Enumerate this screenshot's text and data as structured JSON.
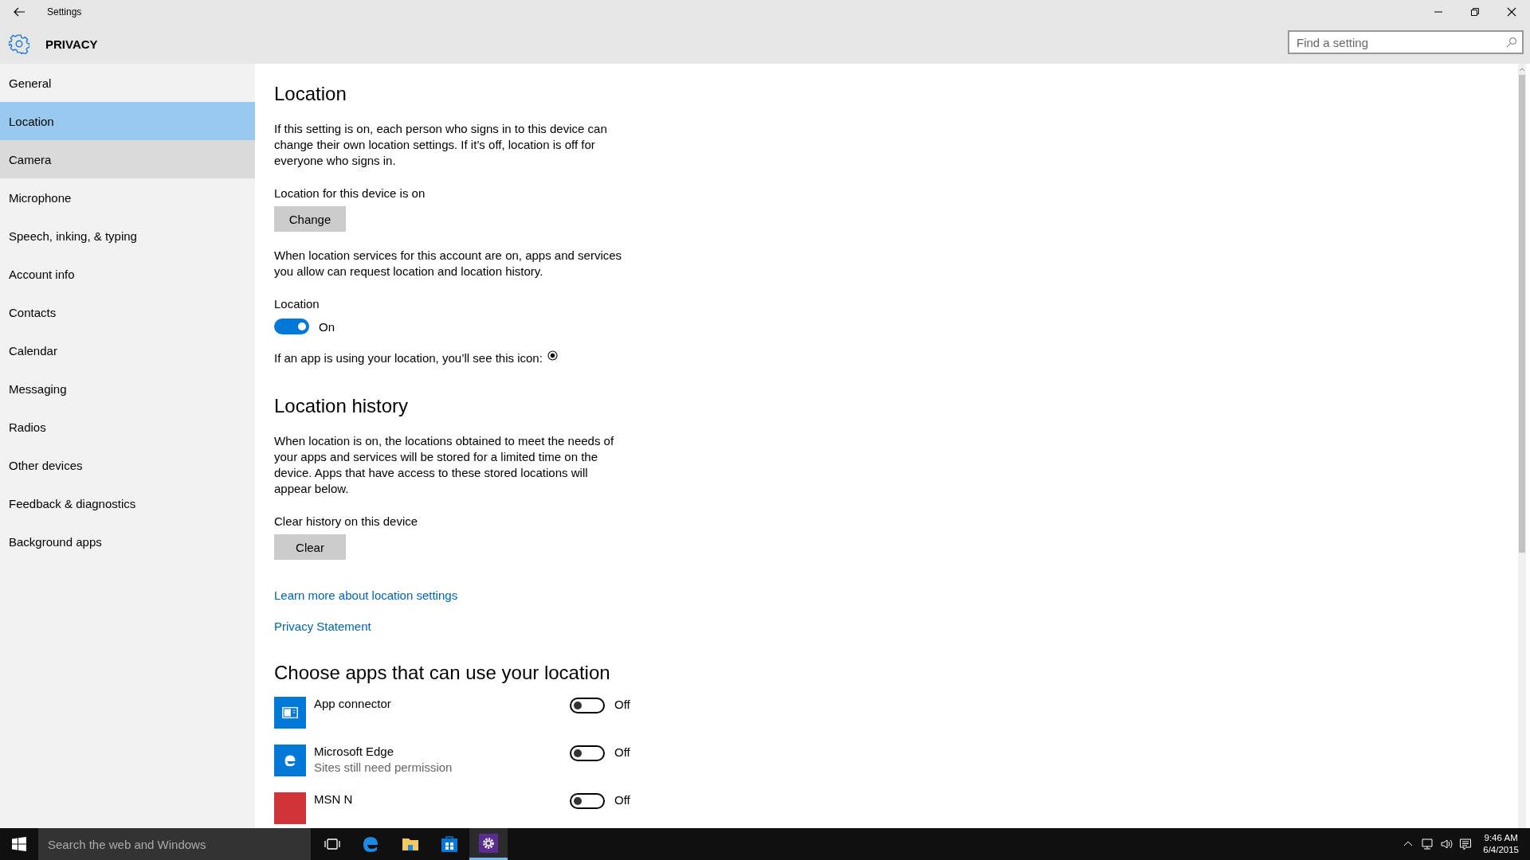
{
  "window": {
    "title": "Settings"
  },
  "header": {
    "title": "PRIVACY"
  },
  "search": {
    "placeholder": "Find a setting"
  },
  "sidebar": {
    "items": [
      {
        "label": "General",
        "selected": false,
        "hovered": false
      },
      {
        "label": "Location",
        "selected": true,
        "hovered": false
      },
      {
        "label": "Camera",
        "selected": false,
        "hovered": true
      },
      {
        "label": "Microphone",
        "selected": false,
        "hovered": false
      },
      {
        "label": "Speech, inking, & typing",
        "selected": false,
        "hovered": false
      },
      {
        "label": "Account info",
        "selected": false,
        "hovered": false
      },
      {
        "label": "Contacts",
        "selected": false,
        "hovered": false
      },
      {
        "label": "Calendar",
        "selected": false,
        "hovered": false
      },
      {
        "label": "Messaging",
        "selected": false,
        "hovered": false
      },
      {
        "label": "Radios",
        "selected": false,
        "hovered": false
      },
      {
        "label": "Other devices",
        "selected": false,
        "hovered": false
      },
      {
        "label": "Feedback & diagnostics",
        "selected": false,
        "hovered": false
      },
      {
        "label": "Background apps",
        "selected": false,
        "hovered": false
      }
    ]
  },
  "content": [
    {
      "kind": "heading",
      "text": "Location"
    },
    {
      "kind": "text",
      "text": "If this setting is on, each person who signs in to this device can change their own location settings. If it’s off, location is off for everyone who signs in."
    },
    {
      "kind": "label",
      "text": "Location for this device is on"
    },
    {
      "kind": "button",
      "text": "Change"
    },
    {
      "kind": "text",
      "text": "When location services for this account are on, apps and services you allow can request location and location history."
    },
    {
      "kind": "toggle",
      "label": "Location",
      "on": true,
      "state_text": "On"
    },
    {
      "kind": "icon_text",
      "text": "If an app is using your location, you’ll see this icon:"
    },
    {
      "kind": "heading",
      "text": "Location history"
    },
    {
      "kind": "text",
      "text": "When location is on, the locations obtained to meet the needs of your apps and services will be stored for a limited time on the device. Apps that have access to these stored locations will appear below."
    },
    {
      "kind": "label",
      "text": "Clear history on this device"
    },
    {
      "kind": "button",
      "text": "Clear"
    },
    {
      "kind": "link",
      "text": "Learn more about location settings"
    },
    {
      "kind": "link",
      "text": "Privacy Statement"
    },
    {
      "kind": "heading",
      "text": "Choose apps that can use your location"
    },
    {
      "kind": "apps",
      "apps": [
        {
          "name": "App connector",
          "kind": "connector",
          "color": "#0078d7",
          "on": false,
          "state_text": "Off"
        },
        {
          "name": "Microsoft Edge",
          "subtitle": "Sites still need permission",
          "kind": "edge",
          "color": "#0078d7",
          "on": false,
          "state_text": "Off"
        },
        {
          "name": "MSN N",
          "kind": "plain",
          "color": "#d13438",
          "on": false,
          "state_text": "Off"
        }
      ]
    }
  ],
  "taskbar": {
    "search_placeholder": "Search the web and Windows",
    "apps": [
      {
        "kind": "taskview",
        "active": false
      },
      {
        "kind": "edge",
        "active": false
      },
      {
        "kind": "explorer",
        "active": false
      },
      {
        "kind": "store",
        "active": false
      },
      {
        "kind": "settings",
        "active": true
      }
    ],
    "time": "9:46 AM",
    "date": "6/4/2015"
  }
}
